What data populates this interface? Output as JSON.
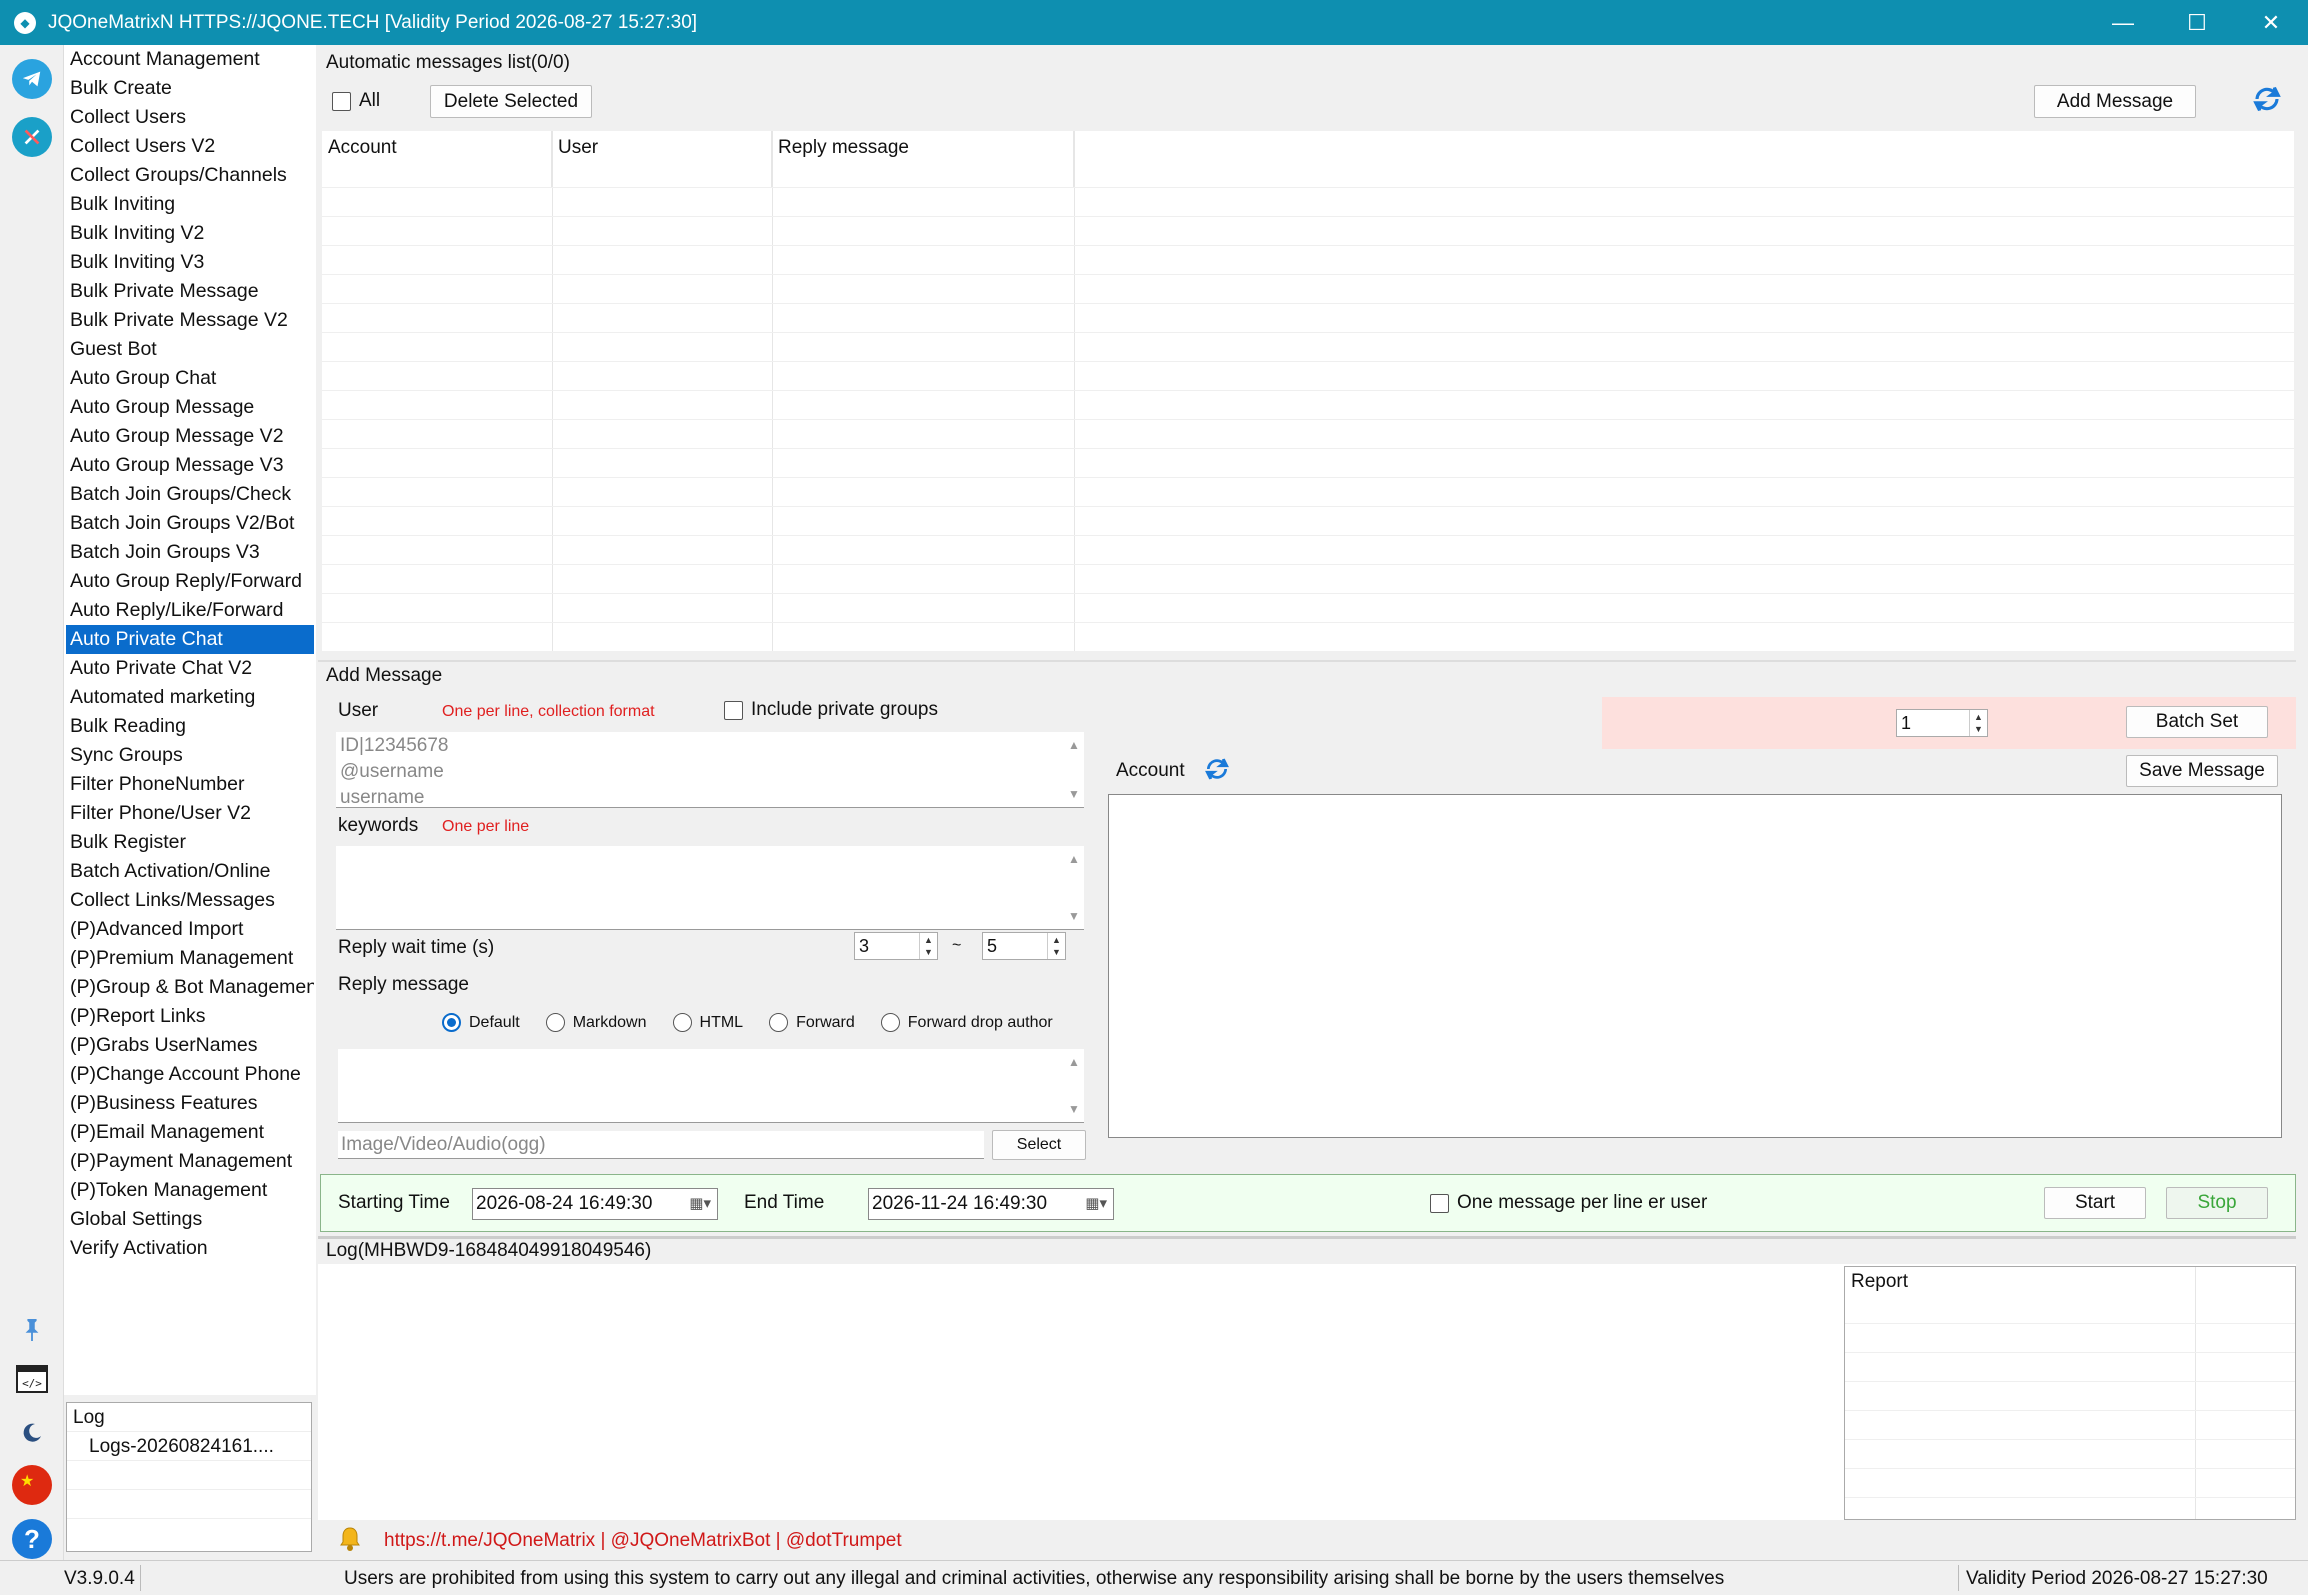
{
  "window": {
    "title": "JQOneMatrixN HTTPS://JQONE.TECH  [Validity Period 2026-08-27 15:27:30]",
    "app_logo": "fish-logo-icon"
  },
  "menu": {
    "items": [
      "Account Management",
      "Bulk Create",
      "Collect Users",
      "Collect Users V2",
      "Collect Groups/Channels",
      "Bulk Inviting",
      "Bulk Inviting V2",
      "Bulk Inviting V3",
      "Bulk Private Message",
      "Bulk Private Message V2",
      "Guest Bot",
      "Auto Group Chat",
      "Auto Group Message",
      "Auto Group Message V2",
      "Auto Group Message V3",
      "Batch Join Groups/Check",
      "Batch Join Groups V2/Bot",
      "Batch Join Groups V3",
      "Auto Group Reply/Forward",
      "Auto Reply/Like/Forward",
      "Auto Private Chat",
      "Auto Private Chat V2",
      "Automated marketing",
      "Bulk Reading",
      "Sync Groups",
      "Filter PhoneNumber",
      "Filter Phone/User V2",
      "Bulk Register",
      "Batch Activation/Online",
      "Collect Links/Messages",
      "(P)Advanced Import",
      "(P)Premium Management",
      "(P)Group & Bot Management",
      "(P)Report Links",
      "(P)Grabs UserNames",
      "(P)Change Account Phone",
      "(P)Business Features",
      "(P)Email Management",
      "(P)Payment Management",
      "(P)Token Management",
      "Global Settings",
      "Verify Activation"
    ],
    "selected": "Auto Private Chat"
  },
  "log_panel": {
    "header": "Log",
    "entry": "Logs-20260824161...."
  },
  "messages_list": {
    "title": "Automatic messages list(0/0)",
    "all_label": "All",
    "delete_selected": "Delete Selected",
    "add_message": "Add Message",
    "columns": [
      "Account",
      "User",
      "Reply message"
    ]
  },
  "add_message": {
    "title": "Add Message",
    "user_label": "User",
    "user_hint": "One per line, collection format",
    "include_private": "Include private groups",
    "user_placeholder": [
      "ID|12345678",
      "@username",
      "username"
    ],
    "keywords_label": "keywords",
    "keywords_hint": "One per line",
    "wait_label": "Reply wait time (s)",
    "wait_min": "3",
    "wait_sep": "~",
    "wait_max": "5",
    "reply_label": "Reply message",
    "modes": [
      "Default",
      "Markdown",
      "HTML",
      "Forward",
      "Forward drop author"
    ],
    "selected_mode": "Default",
    "media_placeholder": "Image/Video/Audio(ogg)",
    "select_button": "Select",
    "batch_value": "1",
    "batch_set": "Batch Set",
    "account_label": "Account",
    "save_message": "Save Message"
  },
  "schedule": {
    "start_label": "Starting Time",
    "start_value": "2026-08-24 16:49:30",
    "end_label": "End Time",
    "end_value": "2026-11-24 16:49:30",
    "one_per_line": "One message per line  er user",
    "start_button": "Start",
    "stop_button": "Stop"
  },
  "log": {
    "title": "Log(MHBWD9-168484049918049546)",
    "report_header": "Report"
  },
  "footer": {
    "links": "https://t.me/JQOneMatrix | @JQOneMatrixBot | @dotTrumpet",
    "version": "V3.9.0.4",
    "notice": "Users are prohibited from using this system to carry out any illegal and criminal activities, otherwise any responsibility arising shall be borne by the users themselves",
    "validity": "Validity Period 2026-08-27 15:27:30"
  },
  "colors": {
    "titlebar": "#0e8fb0",
    "selected": "#0a6ccc",
    "hint_red": "#e02020",
    "stop_green": "#3aa63a"
  }
}
